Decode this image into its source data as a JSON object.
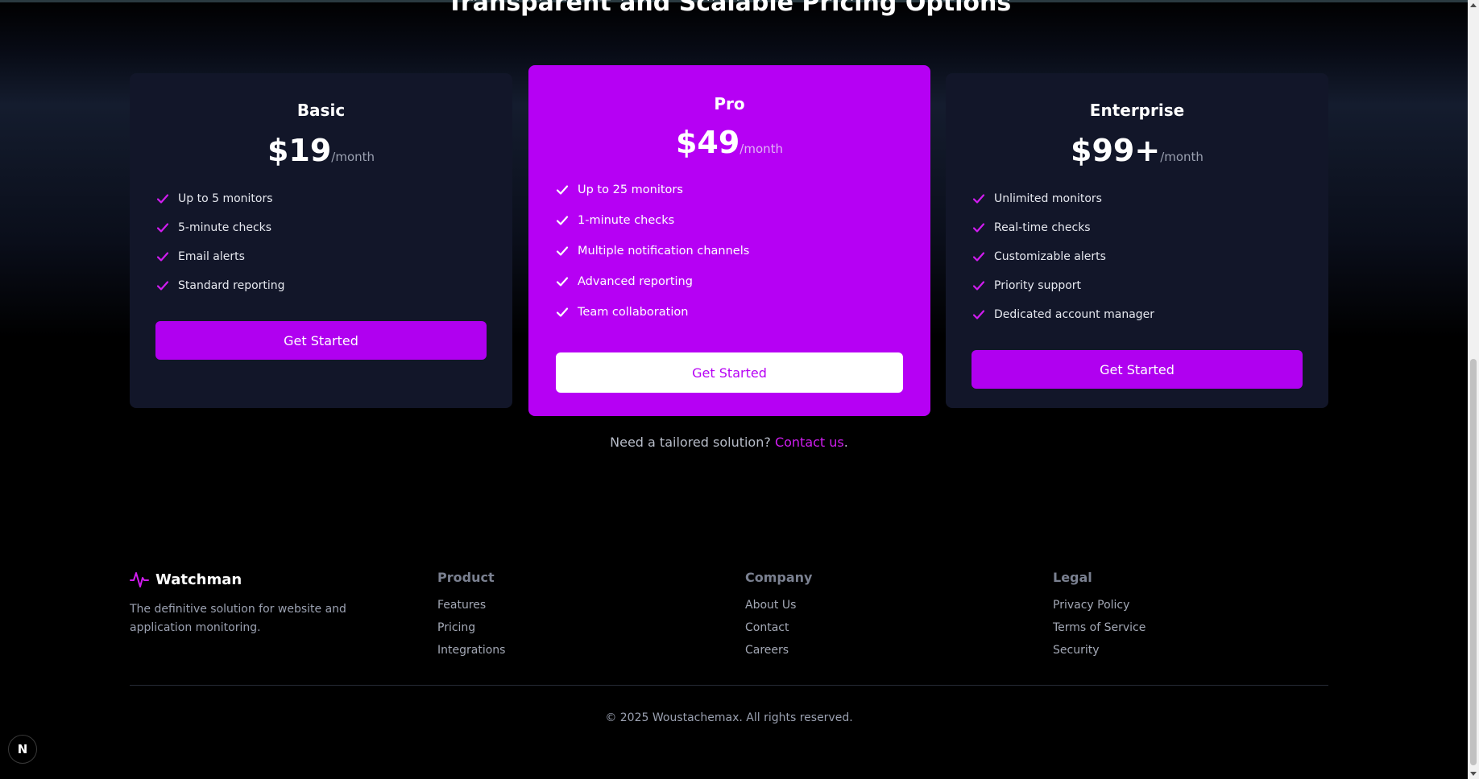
{
  "section_title": "Transparent and Scalable Pricing Options",
  "plans": [
    {
      "name": "Basic",
      "price": "$19",
      "period": "/month",
      "features": [
        "Up to 5 monitors",
        "5-minute checks",
        "Email alerts",
        "Standard reporting"
      ],
      "cta": "Get Started"
    },
    {
      "name": "Pro",
      "price": "$49",
      "period": "/month",
      "features": [
        "Up to 25 monitors",
        "1-minute checks",
        "Multiple notification channels",
        "Advanced reporting",
        "Team collaboration"
      ],
      "cta": "Get Started"
    },
    {
      "name": "Enterprise",
      "price": "$99+",
      "period": "/month",
      "features": [
        "Unlimited monitors",
        "Real-time checks",
        "Customizable alerts",
        "Priority support",
        "Dedicated account manager"
      ],
      "cta": "Get Started"
    }
  ],
  "tailored": {
    "text": "Need a tailored solution?",
    "link": "Contact us",
    "end": "."
  },
  "footer": {
    "brand": "Watchman",
    "brand_icon": "pulse-icon",
    "description": "The definitive solution for website and application monitoring.",
    "columns": {
      "product": {
        "title": "Product",
        "links": [
          "Features",
          "Pricing",
          "Integrations"
        ]
      },
      "company": {
        "title": "Company",
        "links": [
          "About Us",
          "Contact",
          "Careers"
        ]
      },
      "legal": {
        "title": "Legal",
        "links": [
          "Privacy Policy",
          "Terms of Service",
          "Security"
        ]
      }
    },
    "copyright": "© 2025 Woustachemax. All rights reserved."
  },
  "dev_badge": "N",
  "colors": {
    "accent": "#b600f4",
    "card_bg": "#121629",
    "page_bg": "#000000"
  }
}
